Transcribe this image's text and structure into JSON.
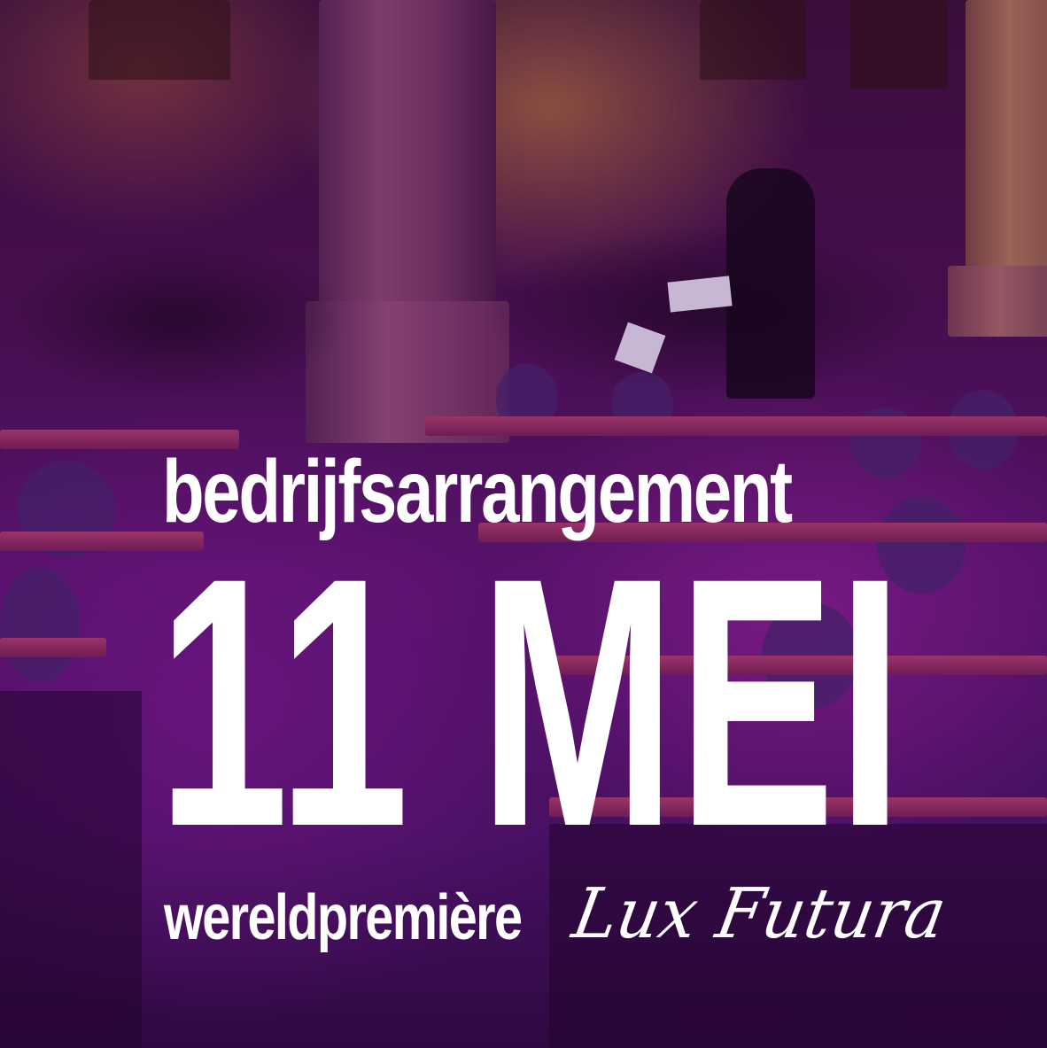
{
  "poster": {
    "headline": "bedrijfsarrangement",
    "date": "11 MEI",
    "premiere_label": "wereldpremière",
    "title_script": "Lux Futura"
  },
  "colors": {
    "text": "#ffffff",
    "tint": "#5a1670"
  }
}
